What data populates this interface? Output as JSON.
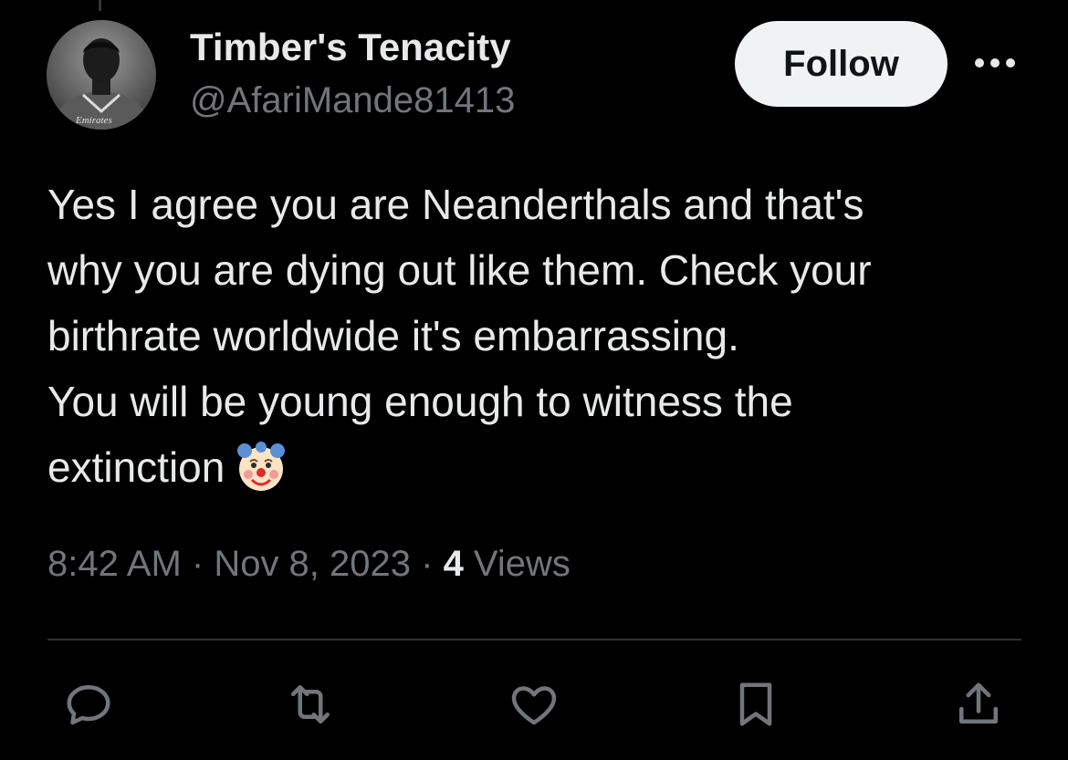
{
  "author": {
    "display_name": "Timber's Tenacity",
    "handle": "@AfariMande81413",
    "avatar_jersey_text": "Emirates"
  },
  "follow_button": {
    "label": "Follow"
  },
  "tweet": {
    "text": "Yes I agree you are Neanderthals and that's\nwhy you are dying out like them. Check your\nbirthrate worldwide it's embarrassing.\nYou will be young enough to witness the\nextinction",
    "emoji": "clown-face"
  },
  "meta": {
    "time": "8:42 AM",
    "separator": " · ",
    "date": "Nov 8, 2023",
    "views_count": "4",
    "views_label": " Views"
  },
  "actions": [
    {
      "icon": "reply-icon"
    },
    {
      "icon": "retweet-icon"
    },
    {
      "icon": "like-icon"
    },
    {
      "icon": "bookmark-icon"
    },
    {
      "icon": "share-icon"
    }
  ],
  "colors": {
    "background": "#000000",
    "text_primary": "#e7e9ea",
    "text_secondary": "#71767b",
    "follow_bg": "#eff3f4",
    "follow_text": "#0f1419",
    "divider": "#2f3336"
  }
}
